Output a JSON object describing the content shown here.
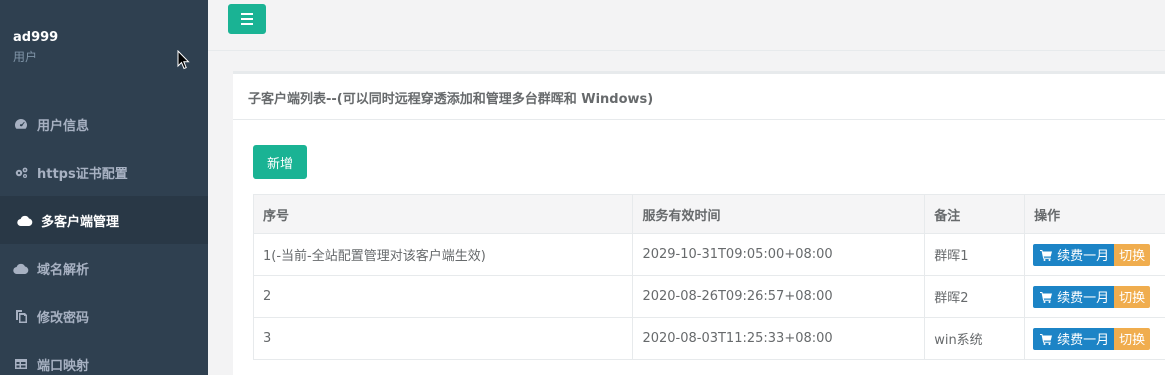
{
  "sidebar": {
    "username": "ad999",
    "role": "用户",
    "items": [
      {
        "label": "用户信息",
        "icon": "dashboard-icon",
        "active": false
      },
      {
        "label": "https证书配置",
        "icon": "gears-icon",
        "active": false
      },
      {
        "label": "多客户端管理",
        "icon": "cloud-icon",
        "active": true
      },
      {
        "label": "域名解析",
        "icon": "cloud-icon",
        "active": false
      },
      {
        "label": "修改密码",
        "icon": "copy-icon",
        "active": false
      },
      {
        "label": "端口映射",
        "icon": "table-icon",
        "active": false
      }
    ]
  },
  "panel": {
    "title": "子客户端列表--(可以同时远程穿透添加和管理多台群晖和 Windows)",
    "add_label": "新增"
  },
  "table": {
    "headers": [
      "序号",
      "服务有效时间",
      "备注",
      "操作"
    ],
    "rows": [
      {
        "index": "1(-当前-全站配置管理对该客户端生效)",
        "expires": "2029-10-31T09:05:00+08:00",
        "note": "群晖1",
        "renew": "续费一月",
        "switch": "切换"
      },
      {
        "index": "2",
        "expires": "2020-08-26T09:26:57+08:00",
        "note": "群晖2",
        "renew": "续费一月",
        "switch": "切换"
      },
      {
        "index": "3",
        "expires": "2020-08-03T11:25:33+08:00",
        "note": "win系统",
        "renew": "续费一月",
        "switch": "切换"
      }
    ]
  },
  "colors": {
    "sidebar_bg": "#2f4050",
    "accent": "#1ab394",
    "renew_blue": "#1c84c6",
    "switch_orange": "#f0ad4e"
  }
}
